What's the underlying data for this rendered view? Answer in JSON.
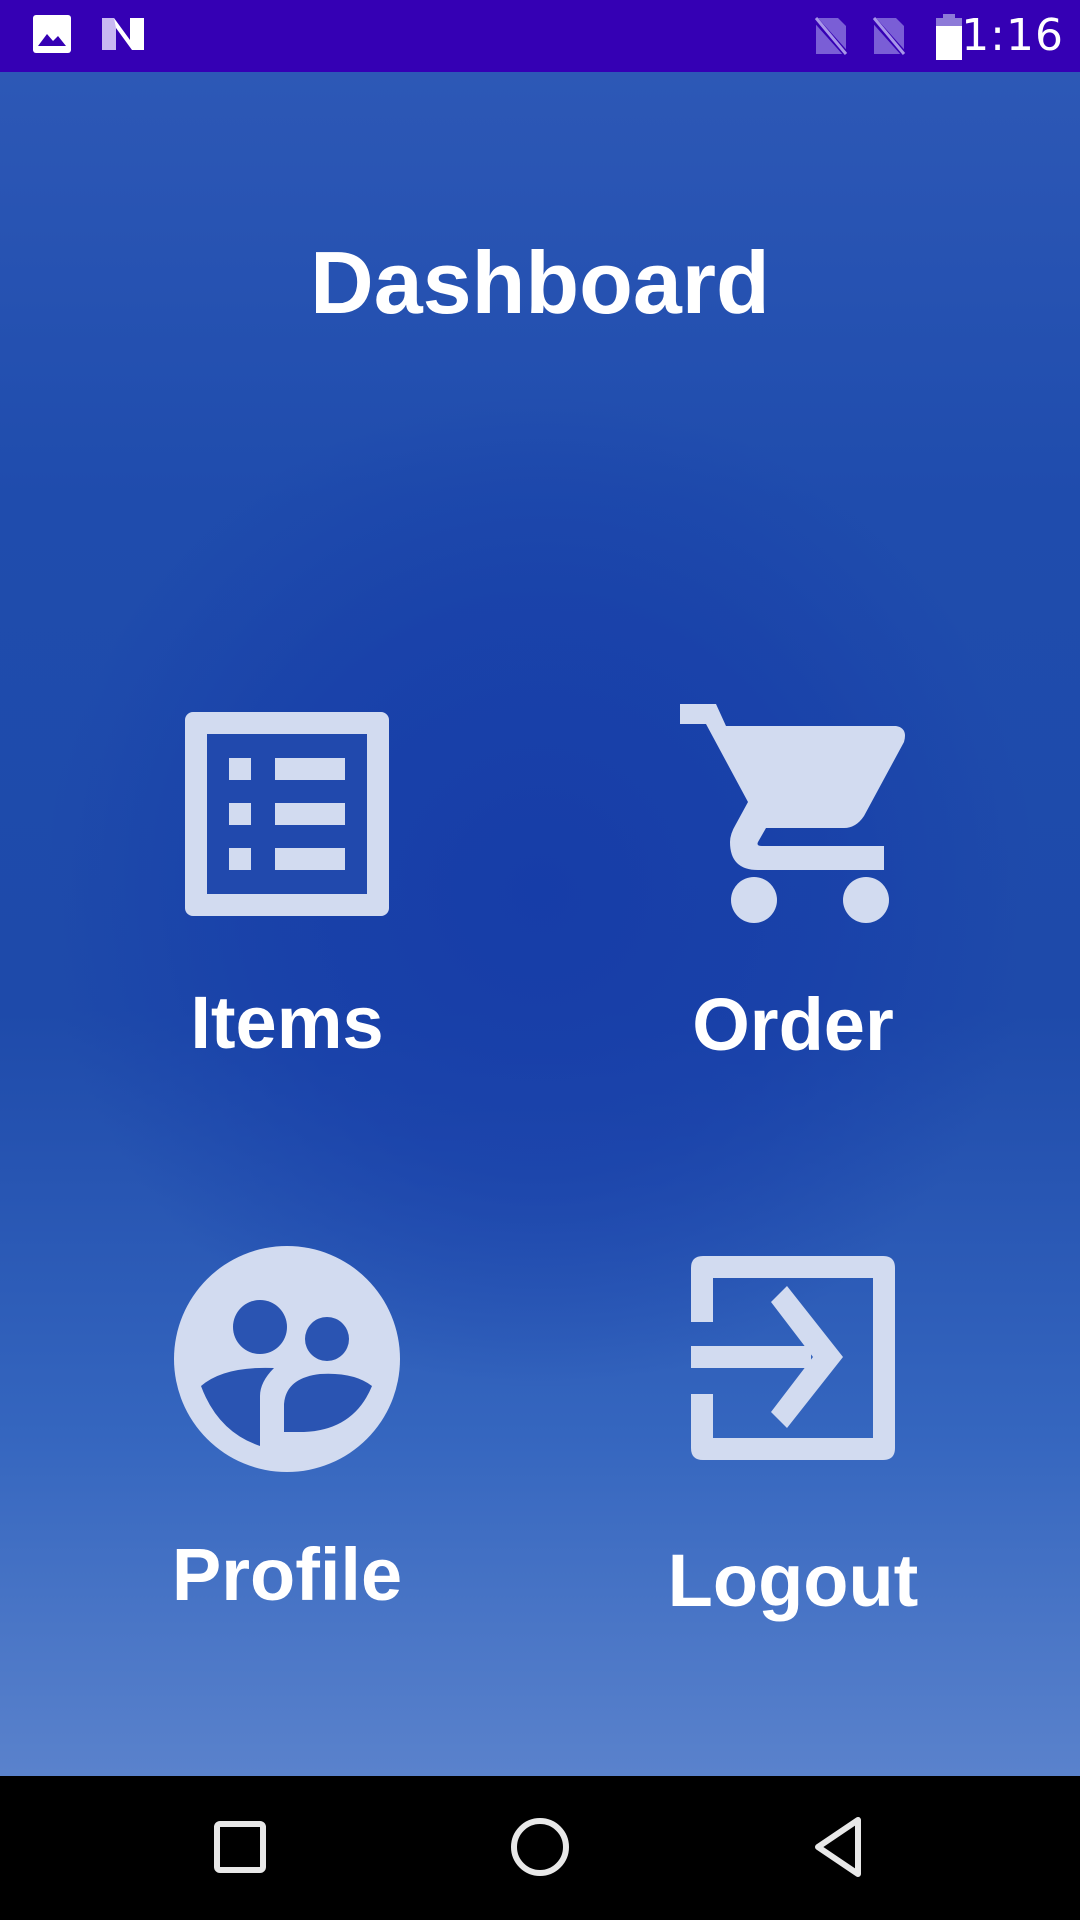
{
  "status_bar": {
    "time": "1:16",
    "background": "#3500b4",
    "icons": [
      "image-icon",
      "n-logo-icon",
      "no-sim-icon",
      "no-sim-icon",
      "battery-icon"
    ]
  },
  "dashboard": {
    "title": "Dashboard",
    "icon_color": "#d2dbf0",
    "tiles": [
      {
        "label": "Items",
        "icon": "list-icon"
      },
      {
        "label": "Order",
        "icon": "cart-icon"
      },
      {
        "label": "Profile",
        "icon": "people-icon"
      },
      {
        "label": "Logout",
        "icon": "logout-icon"
      }
    ]
  },
  "nav_bar": {
    "buttons": [
      "recents-button",
      "home-button",
      "back-button"
    ]
  }
}
